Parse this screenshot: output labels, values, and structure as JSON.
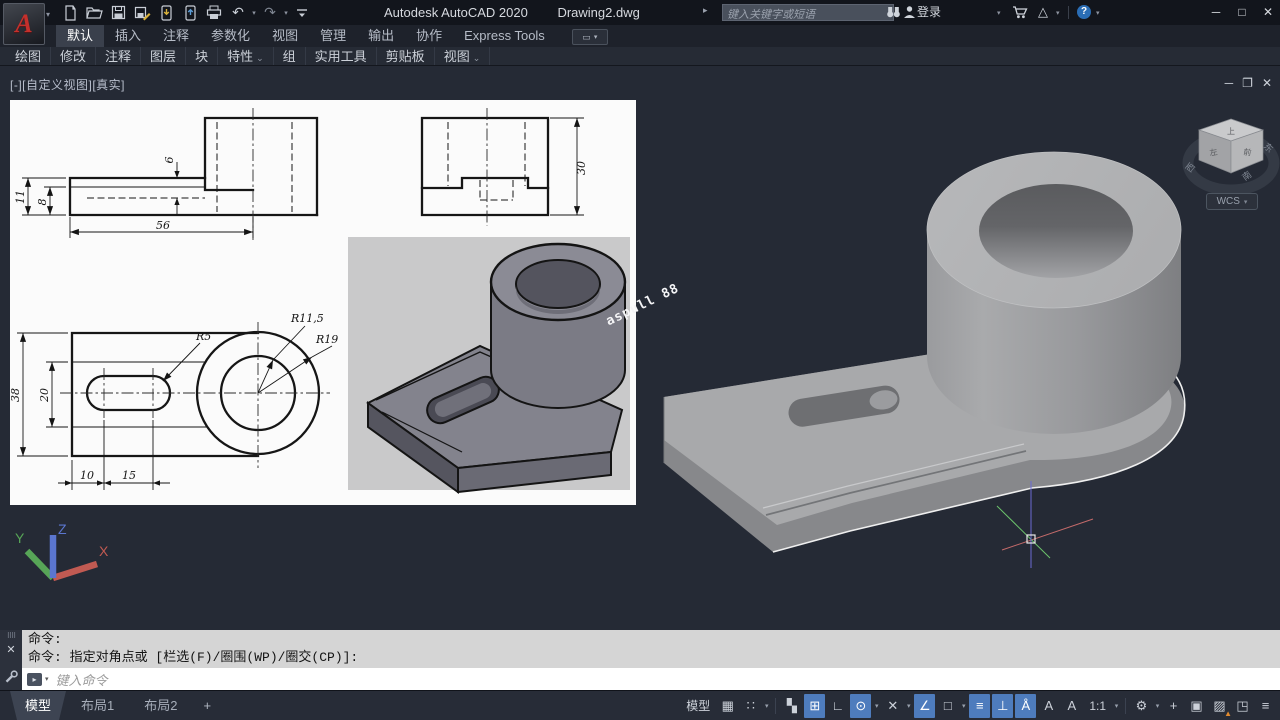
{
  "icons": {
    "caret": "▾",
    "flyout": "⌄",
    "arrow_right": "▸",
    "win_min": "─",
    "win_max": "□",
    "win_close": "✕",
    "doc_min": "─",
    "doc_rest": "❐",
    "doc_close": "✕",
    "undo": "↶",
    "redo": "↷",
    "ribbon_display": "▭",
    "grip": "⠿⠿",
    "cmd_close": "✕",
    "cmd_prompt": "▸",
    "a360": "△",
    "help": "?",
    "grid": "▦",
    "snap": "∷",
    "infer": "▚",
    "dyn_input": "⊞",
    "ortho": "∟",
    "polar": "⊙",
    "isodraft": "✕",
    "osnap_track": "∠",
    "osnap": "□",
    "lineweight": "≡",
    "dyn_ucs": "⊥",
    "ann_vis": "Å",
    "autoscale": "A",
    "ann_person": "A",
    "gear": "⚙",
    "ann_monitor": "+",
    "isolate": "▣",
    "graphics": "▨",
    "graphics_warn": "▲",
    "clean_screen": "◳",
    "customization": "≡"
  },
  "titlebar": {
    "app_title": "Autodesk AutoCAD 2020",
    "doc_title": "Drawing2.dwg",
    "search_placeholder": "键入关键字或短语",
    "signin": "登录"
  },
  "ribbon": {
    "tabs": [
      {
        "label": "默认",
        "active": true
      },
      {
        "label": "插入"
      },
      {
        "label": "注释"
      },
      {
        "label": "参数化"
      },
      {
        "label": "视图"
      },
      {
        "label": "管理"
      },
      {
        "label": "输出"
      },
      {
        "label": "协作"
      },
      {
        "label": "Express Tools"
      }
    ],
    "panels": [
      {
        "label": "绘图"
      },
      {
        "label": "修改"
      },
      {
        "label": "注释"
      },
      {
        "label": "图层"
      },
      {
        "label": "块"
      },
      {
        "label": "特性",
        "flyout": true
      },
      {
        "label": "组"
      },
      {
        "label": "实用工具"
      },
      {
        "label": "剪贴板"
      },
      {
        "label": "视图",
        "flyout": true
      }
    ]
  },
  "viewport": {
    "label": "[-][自定义视图][真实]",
    "watermark": "aspull 88",
    "viewcube": {
      "wcs": "WCS",
      "west": "西",
      "south": "南",
      "east": "东",
      "top": "上",
      "left": "左",
      "front": "前"
    },
    "ucs": {
      "x": "X",
      "y": "Y",
      "z": "Z"
    }
  },
  "inset": {
    "dims": {
      "d56": "56",
      "d11": "11",
      "d8": "8",
      "d6": "6",
      "d30": "30",
      "d38": "38",
      "d20": "20",
      "d10": "10",
      "d15": "15",
      "r5": "R5",
      "r115": "R11,5",
      "r19": "R19"
    }
  },
  "commandline": {
    "history": [
      "命令:",
      "命令: 指定对角点或 [栏选(F)/圈围(WP)/圈交(CP)]:"
    ],
    "placeholder": "键入命令"
  },
  "statusbar": {
    "tabs": [
      {
        "label": "模型",
        "active": true
      },
      {
        "label": "布局1"
      },
      {
        "label": "布局2"
      }
    ],
    "add_tab": "+",
    "model_toggle": "模型",
    "scale": "1:1"
  }
}
